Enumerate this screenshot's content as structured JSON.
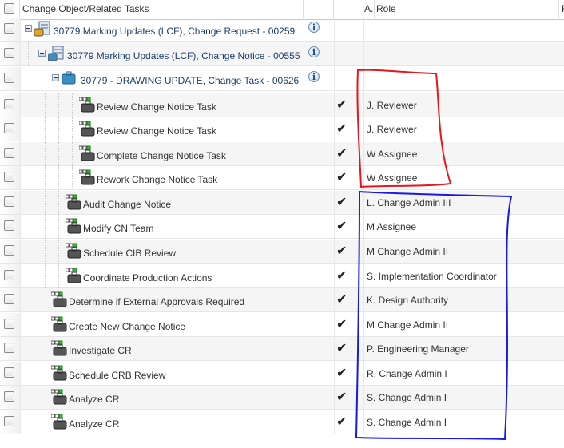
{
  "header": {
    "select_all": "",
    "col_name": "Change Object/Related Tasks",
    "col_a": "A.",
    "col_role": "Role",
    "col_f": "F"
  },
  "objects": [
    {
      "label": "30779 Marking Updates (LCF), Change Request - 00259",
      "icon": "change-request-icon",
      "level": 0
    },
    {
      "label": "30779 Marking Updates (LCF), Change Notice - 00555",
      "icon": "change-notice-icon",
      "level": 1
    },
    {
      "label": "30779 - DRAWING UPDATE, Change Task - 00626",
      "icon": "change-task-icon",
      "level": 2
    }
  ],
  "tasks": [
    {
      "label": "Review Change Notice Task",
      "role": "J. Reviewer",
      "level": 3
    },
    {
      "label": "Review Change Notice Task",
      "role": "J. Reviewer",
      "level": 3
    },
    {
      "label": "Complete Change Notice Task",
      "role": "W Assignee",
      "level": 3
    },
    {
      "label": "Rework Change Notice Task",
      "role": "W Assignee",
      "level": 3
    },
    {
      "label": "Audit Change Notice",
      "role": "L. Change Admin III",
      "level": 2
    },
    {
      "label": "Modify CN Team",
      "role": "M Assignee",
      "level": 2
    },
    {
      "label": "Schedule CIB Review",
      "role": "M Change Admin II",
      "level": 2
    },
    {
      "label": "Coordinate Production Actions",
      "role": "S. Implementation Coordinator",
      "level": 2
    },
    {
      "label": "Determine if External Approvals Required",
      "role": "K. Design Authority",
      "level": 1
    },
    {
      "label": "Create New Change Notice",
      "role": "M Change Admin II",
      "level": 1
    },
    {
      "label": "Investigate CR",
      "role": "P. Engineering Manager",
      "level": 1
    },
    {
      "label": "Schedule CRB Review",
      "role": "R. Change Admin I",
      "level": 1
    },
    {
      "label": "Analyze CR",
      "role": "S. Change Admin I",
      "level": 1
    },
    {
      "label": "Analyze CR",
      "role": "S. Change Admin I",
      "level": 1
    }
  ],
  "annotations": {
    "red": "#e8161b",
    "blue": "#1a1adf"
  }
}
